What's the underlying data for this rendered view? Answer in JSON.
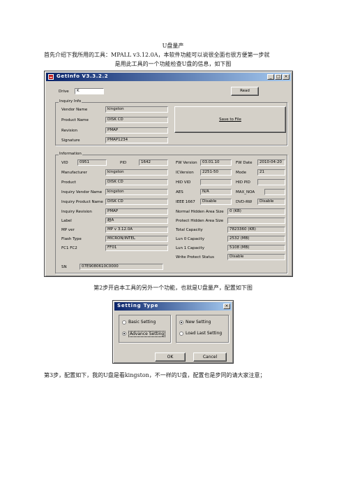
{
  "doc": {
    "title": "U盘量产",
    "intro_line1": "首先介绍下我所用的工具：MPALL v3.12.0A，本软件功能可以说很全面也很方便第一步就",
    "intro_line2": "是用此工具的一个功能检查U盘的信息，如下图",
    "step2": "第2步开启本工具的另外一个功能，也就是U盘量产，配置如下图",
    "step3": "第3步，配置如下，我的U盘是看kingston，不一样的U盘，配置也是步同的请大家注意；"
  },
  "getinfo": {
    "title": "GetInfo V3.3.2.2",
    "drive_label": "Drive",
    "drive_value": "K",
    "read_button": "Read",
    "save_button": "Save to File",
    "inquiry_group": "Inquiry Info",
    "inquiry": {
      "vendor_label": "Vendor Name",
      "vendor_value": "kingston",
      "product_label": "Product Name",
      "product_value": "DISK CD",
      "revision_label": "Revision",
      "revision_value": "PMAP",
      "signature_label": "Signature",
      "signature_value": "PMAP1234"
    },
    "info_group": "Information",
    "info": {
      "vid_label": "VID",
      "vid_value": "0951",
      "pid_label": "PID",
      "pid_value": "1642",
      "fwversion_label": "FW Version",
      "fwversion_value": "03.01.10",
      "fwdate_label": "FW Date",
      "fwdate_value": "2010-04-20",
      "manufacturer_label": "Manufacturer",
      "manufacturer_value": "kingston",
      "icversion_label": "ICVersion",
      "icversion_value": "2251-50",
      "mode_label": "Mode",
      "mode_value": "21",
      "product_label": "Product",
      "product_value": "DISK CD",
      "hidvid_label": "HID VID",
      "hidvid_value": "",
      "hidpid_label": "HID PID",
      "hidpid_value": "",
      "inq_vendor_label": "Inquiry Vendor Name",
      "inq_vendor_value": "kingston",
      "aes_label": "AES",
      "aes_value": "N/A",
      "maxnoa_label": "MAX_NOA",
      "maxnoa_value": "",
      "inq_product_label": "Inquiry Product Name",
      "inq_product_value": "DISK CD",
      "ieee_label": "IEEE 1667",
      "ieee_value": "Disable",
      "dvdrw_label": "DVD-RW",
      "dvdrw_value": "Disable",
      "inq_revision_label": "Inquiry Revision",
      "inq_revision_value": "PMAP",
      "normal_hidden_label": "Normal Hidden Area Size",
      "normal_hidden_value": "0 (KB)",
      "label_label": "Label",
      "label_value": "超A",
      "protect_hidden_label": "Protect Hidden Area Size",
      "protect_hidden_value": "",
      "mpver_label": "MP ver",
      "mpver_value": "MP v 3.12.0A",
      "total_capacity_label": "Total Capacity",
      "total_capacity_value": "7823360 (KB)",
      "flash_label": "Flash Type",
      "flash_value": "MICRON/INTEL",
      "lun0_label": "Lun 0 Capacity",
      "lun0_value": "2532 (MB)",
      "fc_label": "FC1 FC2",
      "fc_value": "FF01",
      "lun1_label": "Lun 1 Capacity",
      "lun1_value": "5108 (MB)",
      "wp_label": "Write Protect Status",
      "wp_value": "Disable",
      "sn_label": "SN",
      "sn_value": "07E9080610C0000"
    }
  },
  "setting": {
    "title": "Setting Type",
    "basic": "Basic Setting",
    "advance": "Advance Setting",
    "new": "New Setting",
    "load": "Load Last Setting",
    "ok": "OK",
    "cancel": "Cancel"
  }
}
